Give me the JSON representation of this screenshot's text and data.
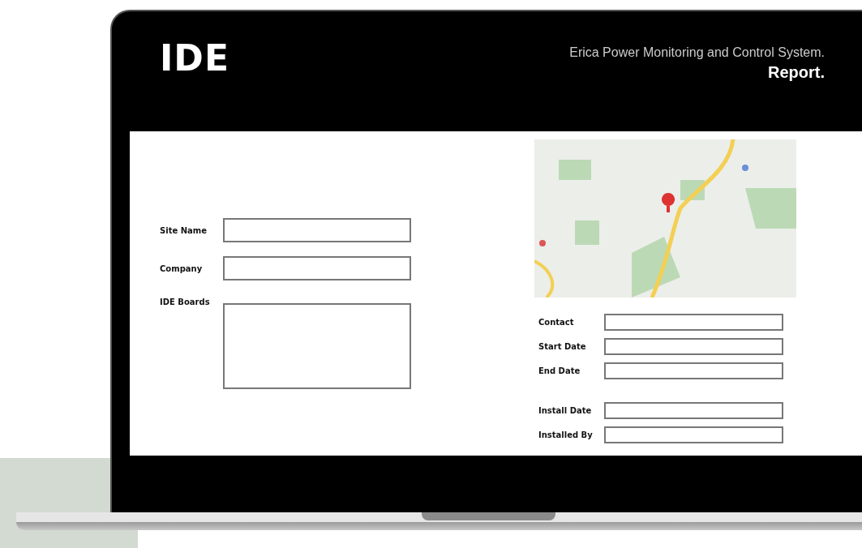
{
  "header": {
    "logo": "IDE",
    "title": "Erica Power Monitoring and Control System.",
    "subtitle": "Report."
  },
  "left_fields": [
    {
      "label": "Site Name",
      "kind": "input"
    },
    {
      "label": "Company",
      "kind": "input"
    },
    {
      "label": "IDE Boards",
      "kind": "textarea"
    }
  ],
  "right_field_groups": [
    [
      {
        "label": "Contact"
      },
      {
        "label": "Start Date"
      },
      {
        "label": "End Date"
      }
    ],
    [
      {
        "label": "Install Date"
      },
      {
        "label": "Installed By"
      }
    ]
  ]
}
